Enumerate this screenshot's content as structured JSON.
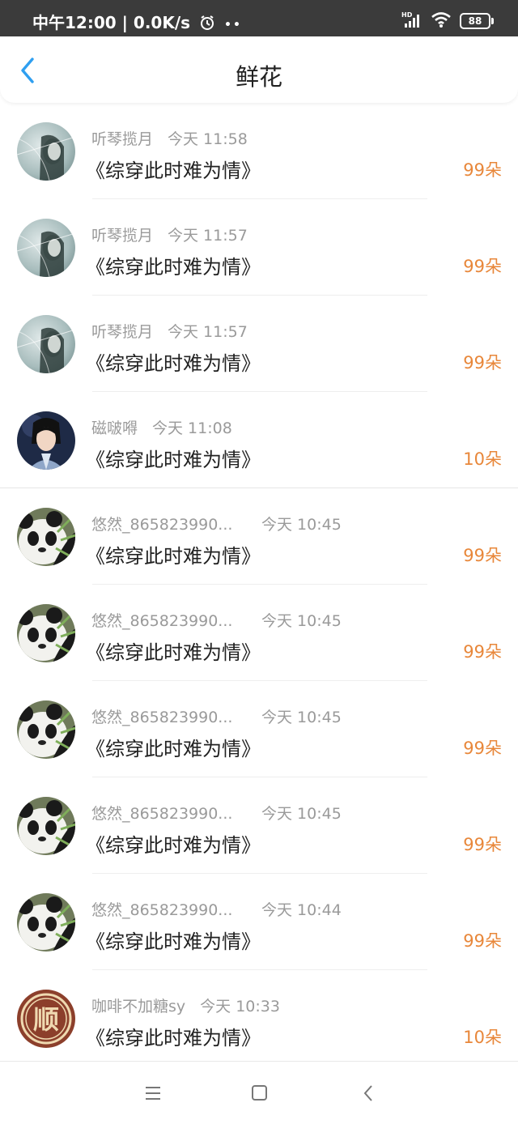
{
  "status_bar": {
    "time": "中午12:00",
    "speed": "0.0K/s",
    "dots": "••",
    "network": "HD",
    "battery": "88",
    "icons": [
      "alarm-clock-icon",
      "signal-icon",
      "wifi-icon",
      "battery-icon"
    ]
  },
  "header": {
    "title": "鲜花",
    "back_icon": "chevron-left-icon",
    "accent_color": "#2f9ff0"
  },
  "colors": {
    "amount": "#e8873a",
    "meta": "#9a9a9a",
    "status_bar": "#3b3b3b"
  },
  "records": [
    {
      "user": "听琴揽月",
      "time": "今天 11:58",
      "book": "《综穿此时难为情》",
      "amount": "99朵",
      "avatar": "woman-in-rain-avatar"
    },
    {
      "user": "听琴揽月",
      "time": "今天 11:57",
      "book": "《综穿此时难为情》",
      "amount": "99朵",
      "avatar": "woman-in-rain-avatar"
    },
    {
      "user": "听琴揽月",
      "time": "今天 11:57",
      "book": "《综穿此时难为情》",
      "amount": "99朵",
      "avatar": "woman-in-rain-avatar"
    },
    {
      "user": "磁啵嘚",
      "time": "今天 11:08",
      "book": "《综穿此时难为情》",
      "amount": "10朵",
      "avatar": "costume-portrait-avatar"
    },
    {
      "user": "悠然_865823990...",
      "time": "今天 10:45",
      "book": "《综穿此时难为情》",
      "amount": "99朵",
      "avatar": "panda-avatar"
    },
    {
      "user": "悠然_865823990...",
      "time": "今天 10:45",
      "book": "《综穿此时难为情》",
      "amount": "99朵",
      "avatar": "panda-avatar"
    },
    {
      "user": "悠然_865823990...",
      "time": "今天 10:45",
      "book": "《综穿此时难为情》",
      "amount": "99朵",
      "avatar": "panda-avatar"
    },
    {
      "user": "悠然_865823990...",
      "time": "今天 10:45",
      "book": "《综穿此时难为情》",
      "amount": "99朵",
      "avatar": "panda-avatar"
    },
    {
      "user": "悠然_865823990...",
      "time": "今天 10:44",
      "book": "《综穿此时难为情》",
      "amount": "99朵",
      "avatar": "panda-avatar"
    },
    {
      "user": "咖啡不加糖sy",
      "time": "今天 10:33",
      "book": "《综穿此时难为情》",
      "amount": "10朵",
      "avatar": "seal-character-avatar",
      "avatar_text": "顺"
    }
  ],
  "nav_bar": {
    "icons": [
      "menu-icon",
      "home-square-icon",
      "back-triangle-icon"
    ]
  }
}
